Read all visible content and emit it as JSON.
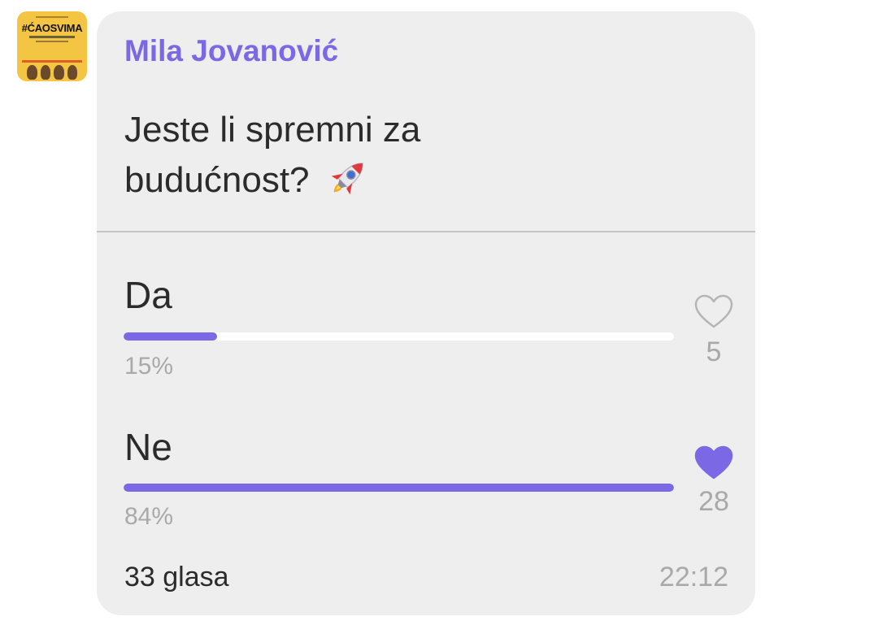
{
  "sender": {
    "name": "Mila Jovanović",
    "avatar_text": "#ĆAOSVIMA",
    "name_color": "#7b68e4"
  },
  "poll": {
    "question": "Jeste li spremni za budućnost?",
    "question_emoji": "rocket",
    "accent_color": "#7b68e4",
    "options": [
      {
        "label": "Da",
        "percent_label": "15%",
        "percent": 0.17,
        "votes": "5",
        "voted_by_me": false,
        "icon": "heart-outline-icon"
      },
      {
        "label": "Ne",
        "percent_label": "84%",
        "percent": 1.0,
        "votes": "28",
        "voted_by_me": true,
        "icon": "heart-filled-icon"
      }
    ],
    "total_votes": "33 glasa",
    "time": "22:12"
  }
}
